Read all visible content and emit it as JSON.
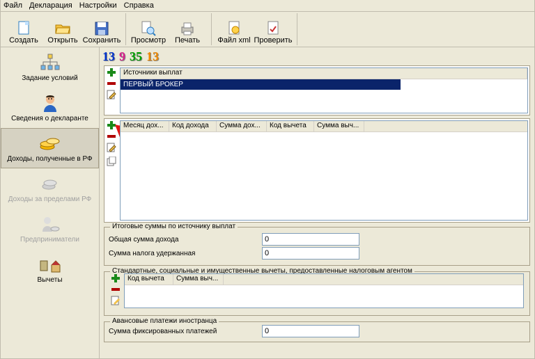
{
  "menu": [
    "Файл",
    "Декларация",
    "Настройки",
    "Справка"
  ],
  "toolbar": {
    "create": "Создать",
    "open": "Открыть",
    "save": "Сохранить",
    "view": "Просмотр",
    "print": "Печать",
    "xml": "Файл xml",
    "check": "Проверить"
  },
  "year_digits": [
    {
      "c": "#0033cc",
      "t": "1"
    },
    {
      "c": "#0033cc",
      "t": "3"
    },
    {
      "c": "#d91f8c",
      "t": "9"
    },
    {
      "c": "#00a000",
      "t": "3"
    },
    {
      "c": "#00a000",
      "t": "5"
    },
    {
      "c": "#ee8800",
      "t": "1"
    },
    {
      "c": "#ee8800",
      "t": "3"
    }
  ],
  "sidebar": {
    "cond": "Задание условий",
    "decl": "Сведения о декларанте",
    "rf": "Доходы, полученные в РФ",
    "abroad": "Доходы за пределами РФ",
    "entr": "Предприниматели",
    "ded": "Вычеты"
  },
  "labels": {
    "sources_hdr": "Источники выплат",
    "first_broker": "ПЕРВЫЙ БРОКЕР",
    "income_cols": [
      "Месяц дох...",
      "Код дохода",
      "Сумма дох...",
      "Код вычета",
      "Сумма выч..."
    ],
    "totals_legend": "Итоговые суммы по источнику выплат",
    "total_income": "Общая сумма дохода",
    "tax_withheld": "Сумма налога удержанная",
    "agent_legend": "Стандартные, социальные и имущественные вычеты, предоставленные налоговым агентом",
    "agent_cols": [
      "Код вычета",
      "Сумма выч..."
    ],
    "advance_legend": "Авансовые платежи иностранца",
    "fixed_pay": "Сумма фиксированных платежей"
  },
  "values": {
    "total_income": "0",
    "tax_withheld": "0",
    "fixed_pay": "0"
  }
}
